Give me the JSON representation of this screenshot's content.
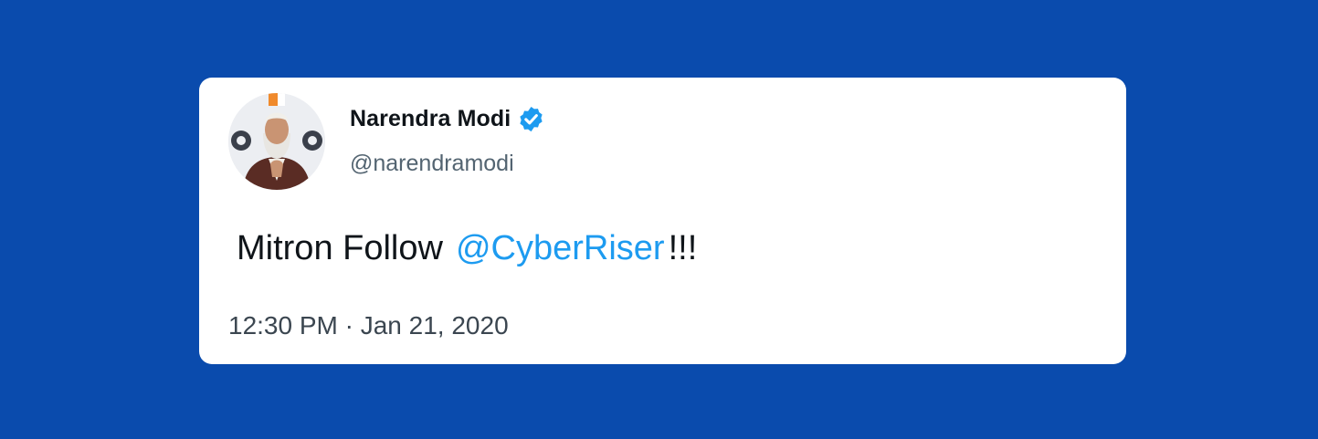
{
  "tweet": {
    "author": {
      "display_name": "Narendra Modi",
      "handle": "@narendramodi",
      "verified": true,
      "verified_icon": "verified-badge-icon",
      "avatar_icon": "avatar-portrait"
    },
    "text_before": "Mitron Follow",
    "mention": "@CyberRiser",
    "text_after": "!!!",
    "timestamp": "12:30 PM · Jan 21, 2020"
  },
  "colors": {
    "background": "#0a4bad",
    "card": "#ffffff",
    "text": "#0f1419",
    "secondary_text": "#536471",
    "mention": "#1d9bf0",
    "verified": "#1d9bf0"
  }
}
